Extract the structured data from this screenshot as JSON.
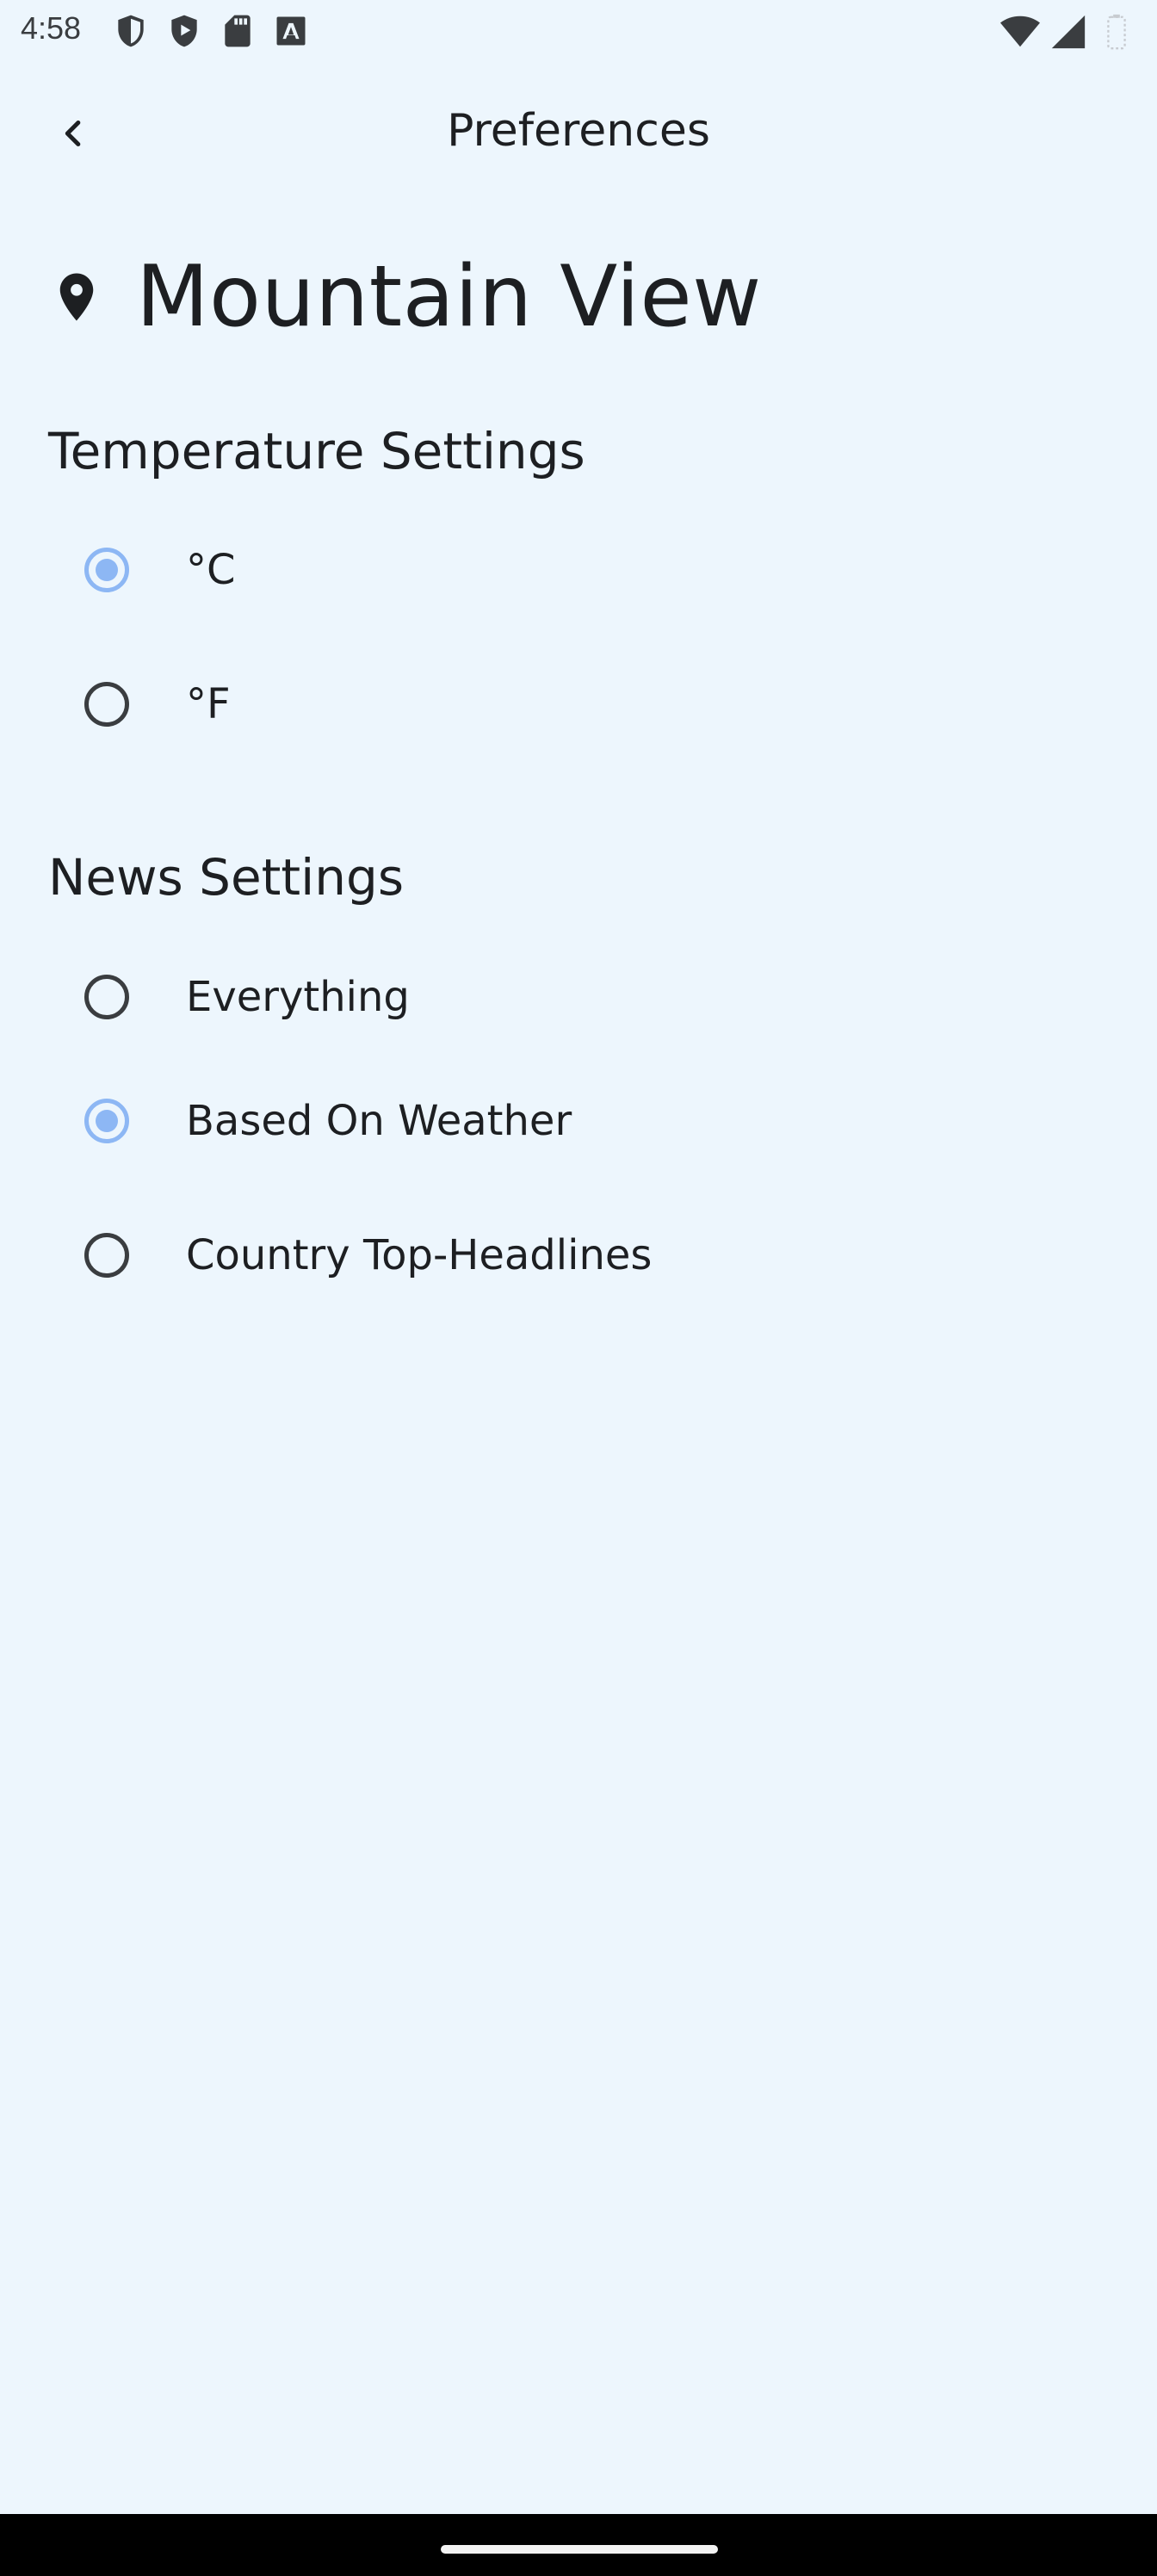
{
  "status_bar": {
    "time": "4:58",
    "left_icons": [
      "shield-outline-icon",
      "shield-play-icon",
      "sd-card-icon",
      "font-a-icon"
    ],
    "right_icons": [
      "wifi-icon",
      "cell-signal-icon",
      "battery-icon"
    ]
  },
  "app_bar": {
    "back_icon": "chevron-left-icon",
    "title": "Preferences"
  },
  "location": {
    "icon": "location-pin-icon",
    "name": "Mountain View"
  },
  "temperature_settings": {
    "title": "Temperature Settings",
    "options": [
      {
        "label": "°C",
        "selected": true
      },
      {
        "label": "°F",
        "selected": false
      }
    ]
  },
  "news_settings": {
    "title": "News Settings",
    "options": [
      {
        "label": "Everything",
        "selected": false
      },
      {
        "label": "Based On Weather",
        "selected": true
      },
      {
        "label": "Country Top-Headlines",
        "selected": false
      }
    ]
  },
  "colors": {
    "background": "#edf6fd",
    "accent": "#8db7f4",
    "text": "#1d1f22"
  }
}
